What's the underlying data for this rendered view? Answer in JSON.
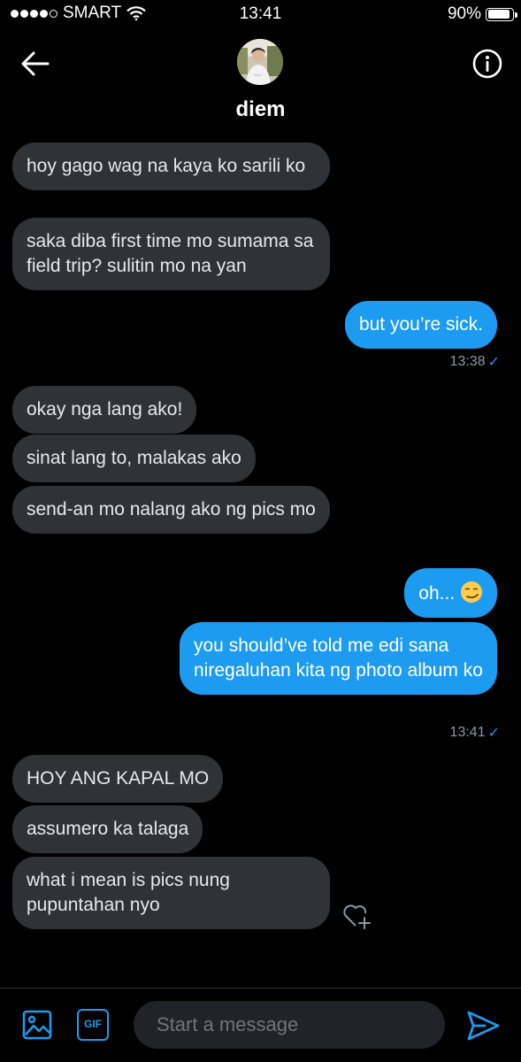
{
  "status_bar": {
    "carrier": "SMART",
    "time": "13:41",
    "battery": "90%",
    "battery_level": 0.9
  },
  "header": {
    "contact_name": "diem"
  },
  "messages": [
    {
      "side": "in",
      "text": "hoy gago wag na kaya ko sarili ko"
    },
    {
      "side": "in",
      "text": "saka diba first time mo sumama sa field trip? sulitin mo na yan"
    },
    {
      "side": "out",
      "text": "but you’re sick."
    },
    {
      "side": "in",
      "text": "okay nga lang ako!"
    },
    {
      "side": "in",
      "text": "sinat lang to, malakas ako"
    },
    {
      "side": "in",
      "text": "send-an mo nalang ako ng pics mo"
    },
    {
      "side": "out",
      "text": "oh... "
    },
    {
      "side": "out",
      "text": "you should’ve told me edi sana niregaluhan kita ng photo album ko"
    },
    {
      "side": "in",
      "text": "HOY ANG KAPAL MO"
    },
    {
      "side": "in",
      "text": "assumero ka talaga"
    },
    {
      "side": "in",
      "text": "what i mean is pics nung pupuntahan nyo"
    }
  ],
  "timestamps": [
    "13:38",
    "13:41"
  ],
  "composer": {
    "placeholder": "Start a message",
    "gif_label": "GIF"
  },
  "colors": {
    "accent": "#1d9bf0",
    "incoming_bubble": "#2f3336",
    "background": "#000000"
  },
  "icons": [
    "back-arrow-icon",
    "info-icon",
    "heart-add-icon",
    "image-icon",
    "gif-icon",
    "send-icon",
    "smirk-emoji-icon",
    "wifi-icon",
    "battery-icon"
  ]
}
